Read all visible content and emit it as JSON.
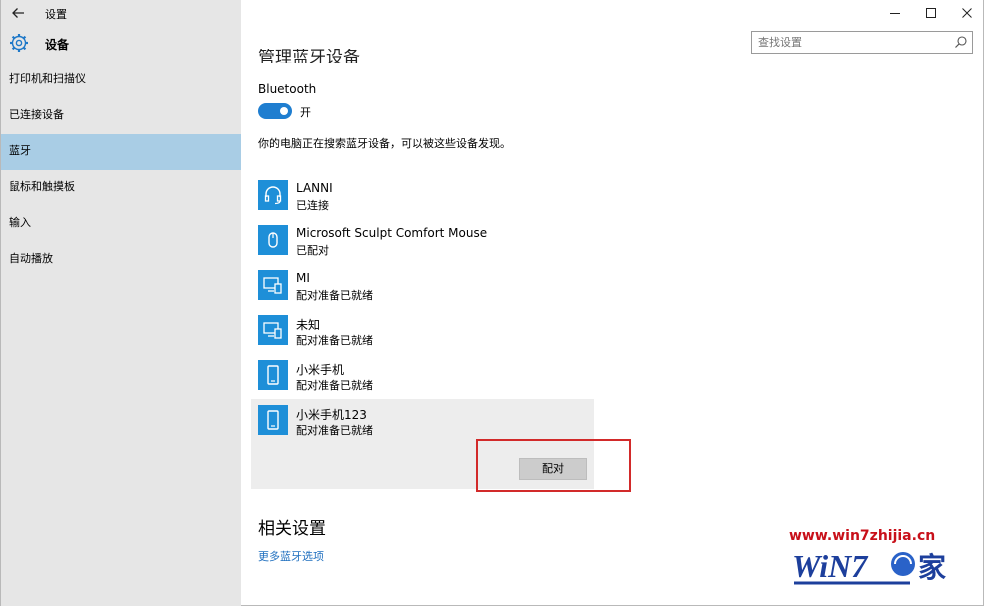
{
  "window": {
    "title": "设置",
    "section_title": "设备",
    "controls": [
      "minimize",
      "maximize",
      "close"
    ]
  },
  "search": {
    "placeholder": "查找设置"
  },
  "nav": {
    "items": [
      {
        "label": "打印机和扫描仪",
        "selected": false
      },
      {
        "label": "已连接设备",
        "selected": false
      },
      {
        "label": "蓝牙",
        "selected": true
      },
      {
        "label": "鼠标和触摸板",
        "selected": false
      },
      {
        "label": "输入",
        "selected": false
      },
      {
        "label": "自动播放",
        "selected": false
      }
    ]
  },
  "content": {
    "cut_heading": "管理蓝牙设备",
    "bluetooth_label": "Bluetooth",
    "toggle_state": "开",
    "search_status": "你的电脑正在搜索蓝牙设备，可以被这些设备发现。",
    "devices": [
      {
        "name": "LANNI",
        "status": "已连接",
        "icon": "headset-icon"
      },
      {
        "name": "Microsoft Sculpt Comfort Mouse",
        "status": "已配对",
        "icon": "mouse-icon"
      },
      {
        "name": "MI",
        "status": "配对准备已就绪",
        "icon": "computer-phone-icon"
      },
      {
        "name": "未知",
        "status": "配对准备已就绪",
        "icon": "computer-phone-icon"
      },
      {
        "name": "小米手机",
        "status": "配对准备已就绪",
        "icon": "phone-icon"
      },
      {
        "name": "小米手机123",
        "status": "配对准备已就绪",
        "icon": "phone-icon"
      }
    ],
    "pair_button": "配对",
    "related_heading": "相关设置",
    "more_link": "更多蓝牙选项"
  },
  "watermark": {
    "url": "www.win7zhijia.cn",
    "logo_text": "WiN7",
    "logo_suffix": "家"
  },
  "colors": {
    "accent": "#1e8fd8",
    "nav_selected": "#a9cde5",
    "left_pane": "#e6e6e6",
    "highlight_box": "#d22a2a",
    "link": "#1f6fbf"
  }
}
